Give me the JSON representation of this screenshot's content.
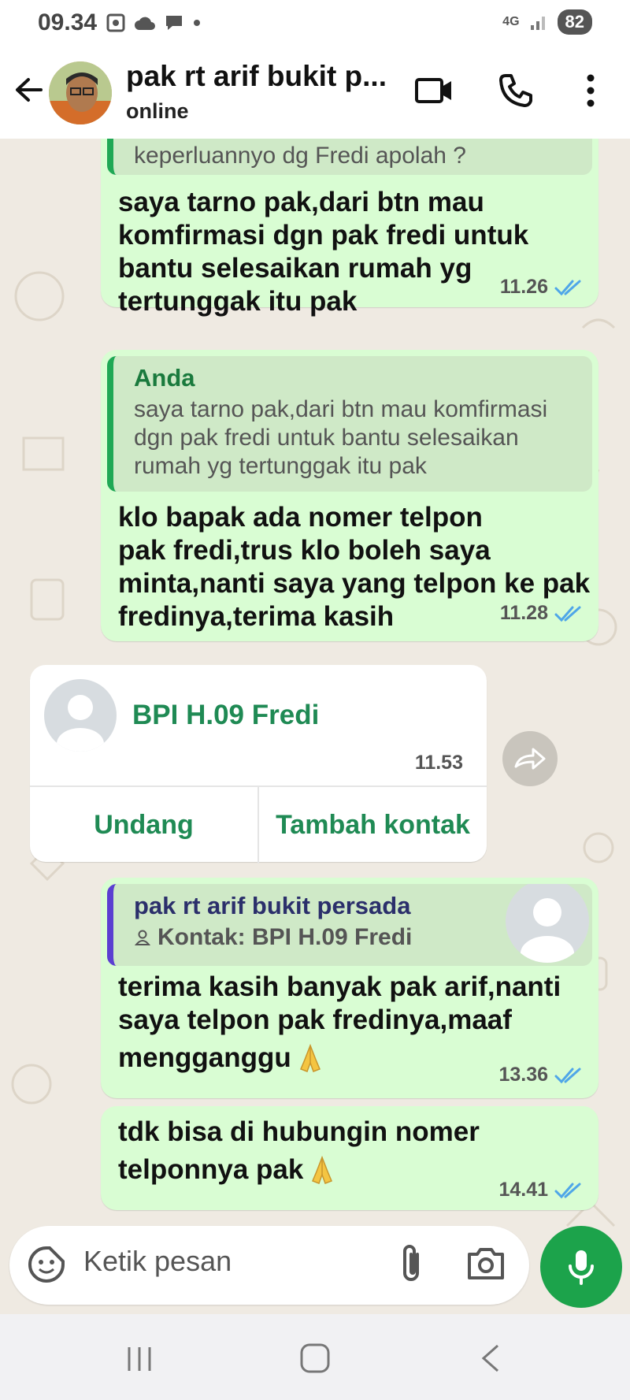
{
  "status_bar": {
    "time": "09.34",
    "network": "4G",
    "battery": "82"
  },
  "header": {
    "contact_name": "pak rt arif bukit p...",
    "status": "online"
  },
  "messages": [
    {
      "quote_text": "keperluannyo dg Fredi apolah ?",
      "text_lines": [
        "saya tarno pak,dari btn mau",
        "komfirmasi dgn pak fredi untuk",
        "bantu selesaikan rumah yg",
        "tertunggak itu pak"
      ],
      "time": "11.26"
    },
    {
      "quote_author": "Anda",
      "quote_text_lines": [
        "saya tarno pak,dari btn mau komfirmasi",
        "dgn pak fredi untuk bantu selesaikan",
        "rumah yg tertunggak itu pak"
      ],
      "text_lines": [
        "klo bapak ada nomer telpon",
        "pak fredi,trus klo boleh saya",
        "minta,nanti saya yang telpon ke pak",
        "fredinya,terima kasih"
      ],
      "time": "11.28"
    },
    {
      "quote_author": "pak rt arif bukit persada",
      "quote_contact": "Kontak: BPI H.09 Fredi",
      "text_lines": [
        "terima kasih banyak pak arif,nanti",
        "saya telpon pak fredinya,maaf",
        "mengganggu"
      ],
      "time": "13.36"
    },
    {
      "text_lines": [
        "tdk bisa di hubungin nomer",
        "telponnya pak"
      ],
      "time": "14.41"
    }
  ],
  "contact_card": {
    "name": "BPI H.09 Fredi",
    "time": "11.53",
    "invite_label": "Undang",
    "add_label": "Tambah kontak"
  },
  "composer": {
    "placeholder": "Ketik pesan"
  },
  "colors": {
    "outgoing_bubble": "#d9fdd3",
    "accent": "#1ca34b",
    "read_ticks": "#4fa6e8"
  }
}
